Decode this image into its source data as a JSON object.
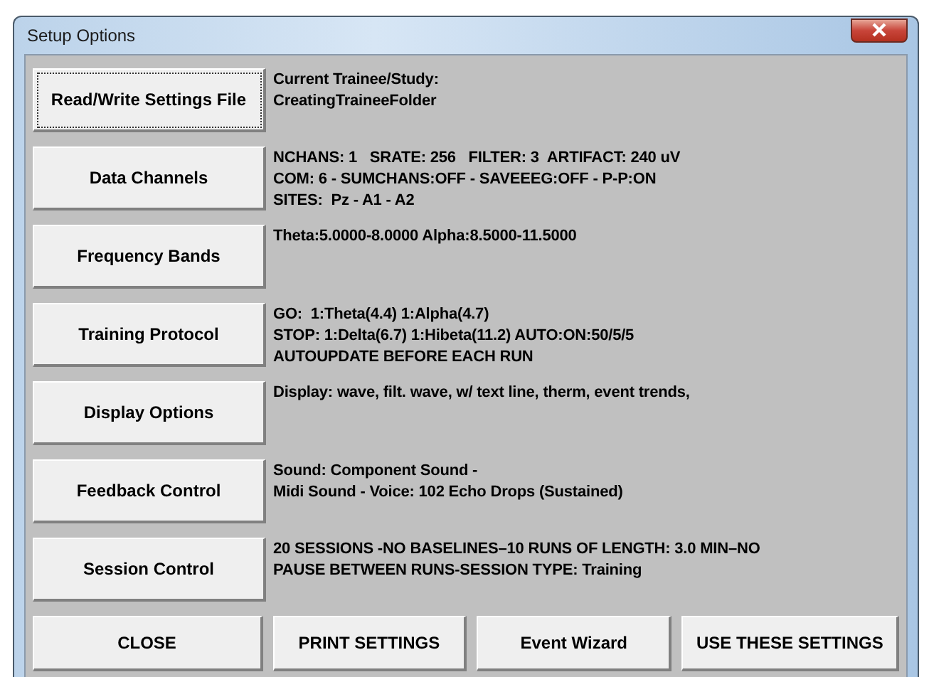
{
  "window": {
    "title": "Setup Options"
  },
  "sections": [
    {
      "button": "Read/Write Settings File",
      "focused": true,
      "lines": [
        "Current Trainee/Study:",
        "CreatingTraineeFolder"
      ]
    },
    {
      "button": "Data Channels",
      "focused": false,
      "lines": [
        "NCHANS: 1   SRATE: 256   FILTER: 3  ARTIFACT: 240 uV",
        "COM: 6 - SUMCHANS:OFF - SAVEEEG:OFF - P-P:ON",
        "SITES:  Pz - A1 - A2"
      ]
    },
    {
      "button": "Frequency Bands",
      "focused": false,
      "lines": [
        "Theta:5.0000-8.0000 Alpha:8.5000-11.5000"
      ]
    },
    {
      "button": "Training Protocol",
      "focused": false,
      "lines": [
        "GO:  1:Theta(4.4) 1:Alpha(4.7)",
        "STOP: 1:Delta(6.7) 1:Hibeta(11.2) AUTO:ON:50/5/5",
        "AUTOUPDATE BEFORE EACH RUN"
      ]
    },
    {
      "button": "Display Options",
      "focused": false,
      "lines": [
        "Display: wave, filt. wave, w/ text line, therm, event trends,"
      ]
    },
    {
      "button": "Feedback Control",
      "focused": false,
      "lines": [
        "Sound: Component Sound -",
        "Midi Sound - Voice: 102 Echo Drops (Sustained)"
      ]
    },
    {
      "button": "Session Control",
      "focused": false,
      "lines": [
        "20 SESSIONS -NO BASELINES–10 RUNS OF LENGTH: 3.0 MIN–NO",
        "PAUSE BETWEEN RUNS-SESSION TYPE: Training"
      ]
    }
  ],
  "buttons": [
    "CLOSE",
    "PRINT SETTINGS",
    "Event Wizard",
    "USE THESE SETTINGS"
  ]
}
